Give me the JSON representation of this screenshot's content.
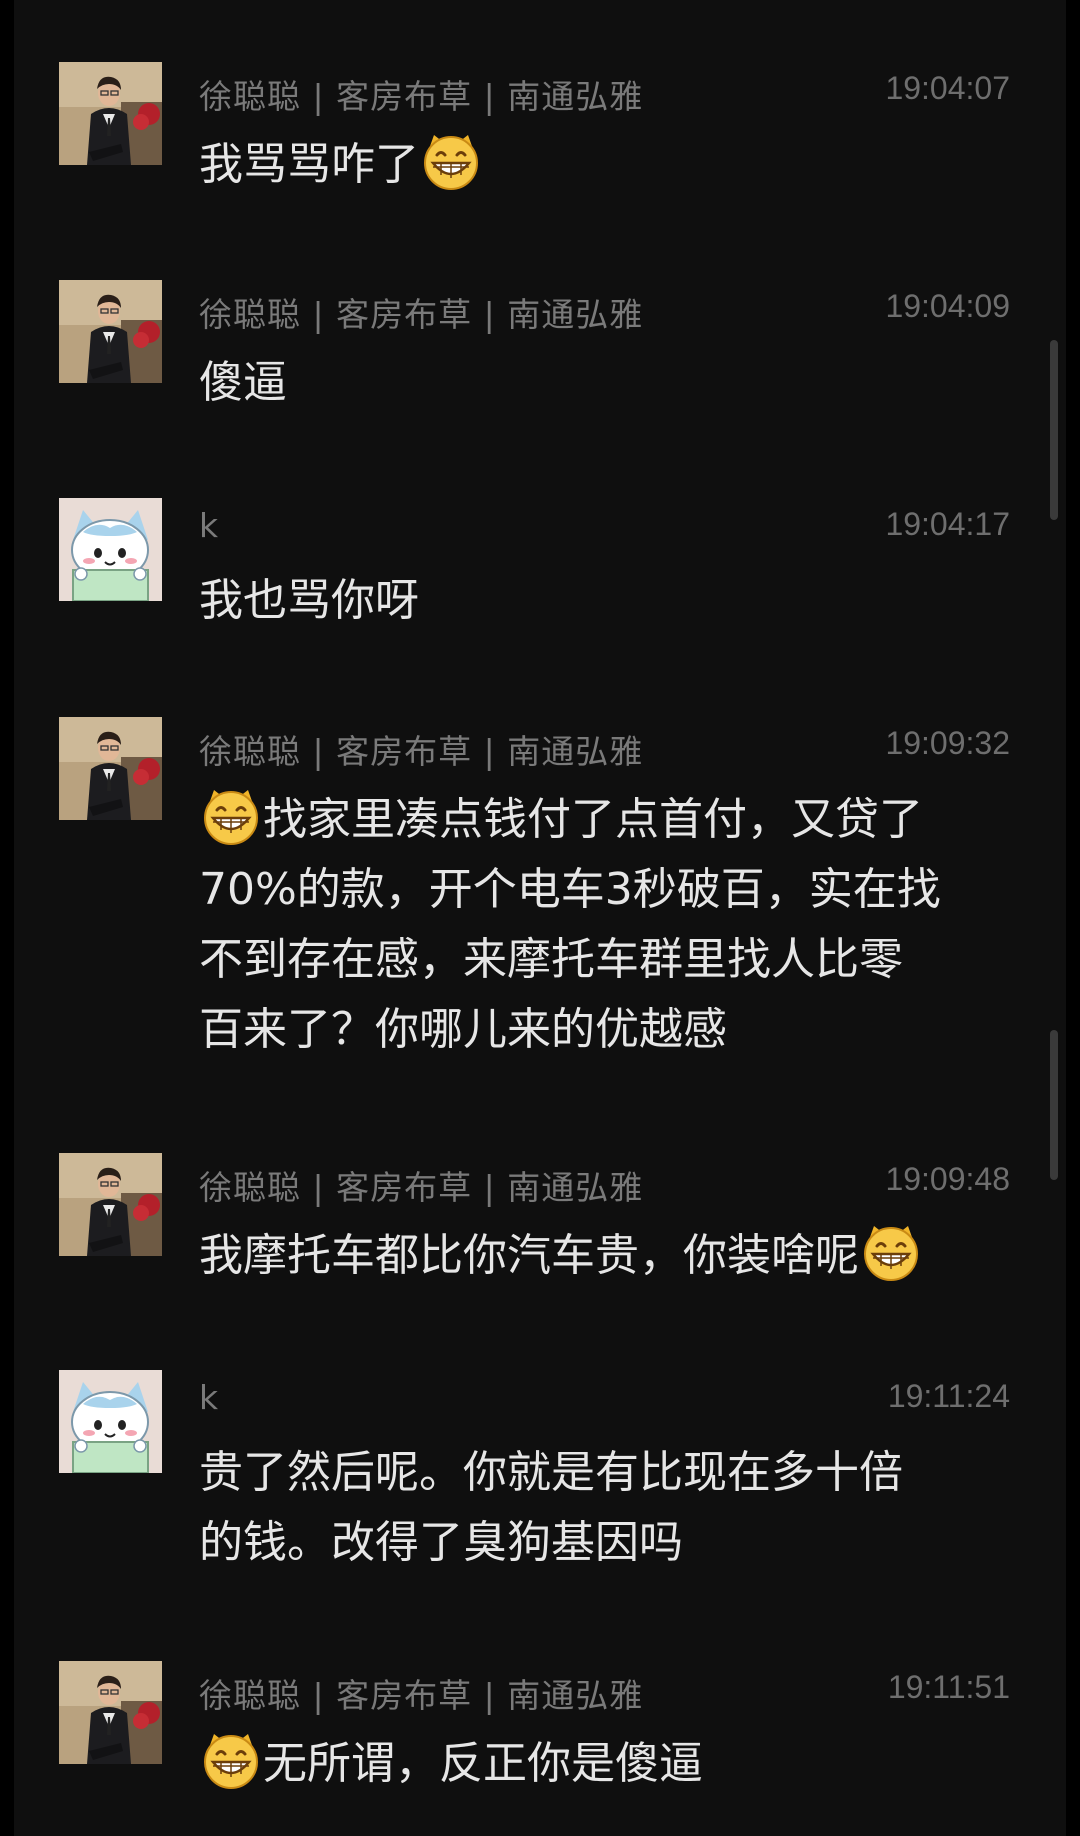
{
  "messages": [
    {
      "sender": "徐聪聪 | 客房布草 | 南通弘雅",
      "time": "19:04:07",
      "text": "我骂骂咋了",
      "avatar": "man-suit-avatar",
      "emoji_leading": false,
      "emoji_trailing": true
    },
    {
      "sender": "徐聪聪 | 客房布草 | 南通弘雅",
      "time": "19:04:09",
      "text": "傻逼",
      "avatar": "man-suit-avatar",
      "emoji_leading": false,
      "emoji_trailing": false
    },
    {
      "sender": "k",
      "time": "19:04:17",
      "text": "我也骂你呀",
      "avatar": "cartoon-cat-avatar",
      "emoji_leading": false,
      "emoji_trailing": false
    },
    {
      "sender": "徐聪聪 | 客房布草 | 南通弘雅",
      "time": "19:09:32",
      "lines": [
        "找家里凑点钱付了点首付，又贷了",
        "70%的款，开个电车3秒破百，实在找",
        "不到存在感，来摩托车群里找人比零",
        "百来了？你哪儿来的优越感"
      ],
      "avatar": "man-suit-avatar",
      "emoji_leading": true,
      "emoji_trailing": false
    },
    {
      "sender": "徐聪聪 | 客房布草 | 南通弘雅",
      "time": "19:09:48",
      "text": "我摩托车都比你汽车贵，你装啥呢",
      "avatar": "man-suit-avatar",
      "emoji_leading": false,
      "emoji_trailing": true
    },
    {
      "sender": "k",
      "time": "19:11:24",
      "lines": [
        "贵了然后呢。你就是有比现在多十倍",
        "的钱。改得了臭狗基因吗"
      ],
      "avatar": "cartoon-cat-avatar",
      "emoji_leading": false,
      "emoji_trailing": false
    },
    {
      "sender": "徐聪聪 | 客房布草 | 南通弘雅",
      "time": "19:11:51",
      "text": "无所谓，反正你是傻逼",
      "avatar": "man-suit-avatar",
      "emoji_leading": true,
      "emoji_trailing": false
    }
  ],
  "emoji_icon": "grinning-face-icon",
  "colors": {
    "background": "#0f0f0f",
    "text": "#e6e6e6",
    "meta": "#7a7a7a",
    "emoji": "#f7c948"
  }
}
